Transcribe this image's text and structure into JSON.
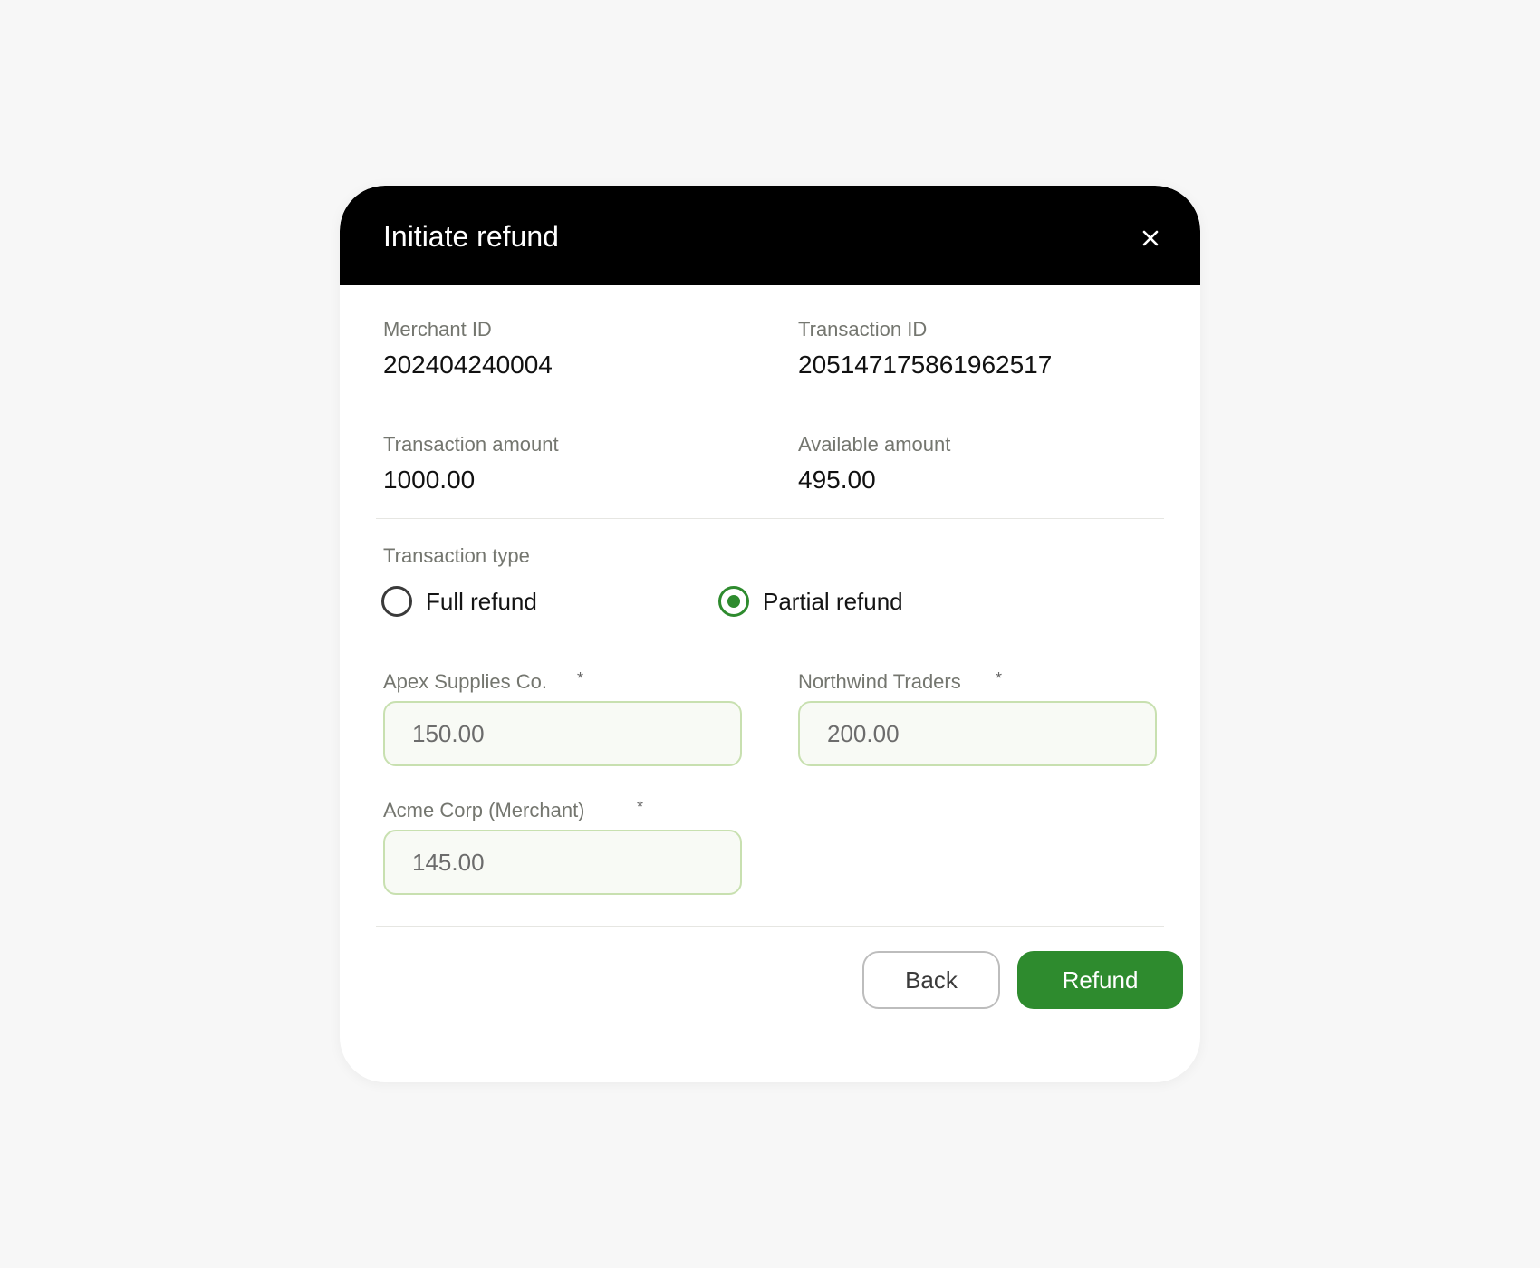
{
  "modal": {
    "title": "Initiate refund",
    "close_icon": "close-icon"
  },
  "details": {
    "merchant_id_label": "Merchant ID",
    "merchant_id_value": "202404240004",
    "transaction_id_label": "Transaction ID",
    "transaction_id_value": "205147175861962517",
    "transaction_amount_label": "Transaction amount",
    "transaction_amount_value": "1000.00",
    "available_amount_label": "Available amount",
    "available_amount_value": "495.00"
  },
  "transaction_type": {
    "label": "Transaction type",
    "options": [
      {
        "label": "Full refund",
        "selected": false
      },
      {
        "label": "Partial refund",
        "selected": true
      }
    ]
  },
  "amounts": [
    {
      "label": "Apex Supplies Co.",
      "required_mark": "*",
      "value": "150.00"
    },
    {
      "label": "Northwind Traders",
      "required_mark": "*",
      "value": "200.00"
    },
    {
      "label": "Acme Corp (Merchant)",
      "required_mark": "*",
      "value": "145.00"
    }
  ],
  "actions": {
    "back_label": "Back",
    "refund_label": "Refund"
  },
  "colors": {
    "header_bg": "#000000",
    "accent_green": "#2e8b2e",
    "input_border": "#c8e0b0",
    "page_bg": "#f7f7f7"
  }
}
